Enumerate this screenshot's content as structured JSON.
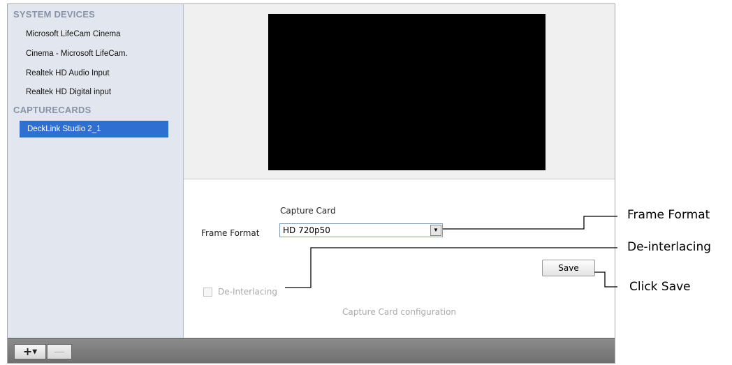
{
  "sidebar": {
    "sections": [
      {
        "header": "SYSTEM DEVICES",
        "items": [
          "Microsoft LifeCam Cinema",
          "Cinema - Microsoft LifeCam.",
          "Realtek HD Audio Input",
          "Realtek HD Digital input"
        ]
      },
      {
        "header": "CAPTURECARDS",
        "items": [
          "DeckLink Studio 2_1"
        ]
      }
    ],
    "selected_item": "DeckLink Studio 2_1"
  },
  "config": {
    "section_title": "Capture Card",
    "frame_format_label": "Frame Format",
    "frame_format_value": "HD 720p50",
    "save_label": "Save",
    "deinterlacing_label": "De-Interlacing",
    "deinterlacing_checked": false,
    "footer_text": "Capture Card configuration"
  },
  "toolbar": {
    "add_icon": "plus-icon",
    "remove_icon": "minus-icon"
  },
  "callouts": {
    "frame_format": "Frame Format",
    "deinterlacing": "De-interlacing",
    "save": "Click Save"
  },
  "colors": {
    "sidebar_bg": "#e1e6ef",
    "section_header": "#8a93a6",
    "selection": "#2f6fd1",
    "toolbar": "#7a7a7a",
    "preview": "#000000"
  }
}
